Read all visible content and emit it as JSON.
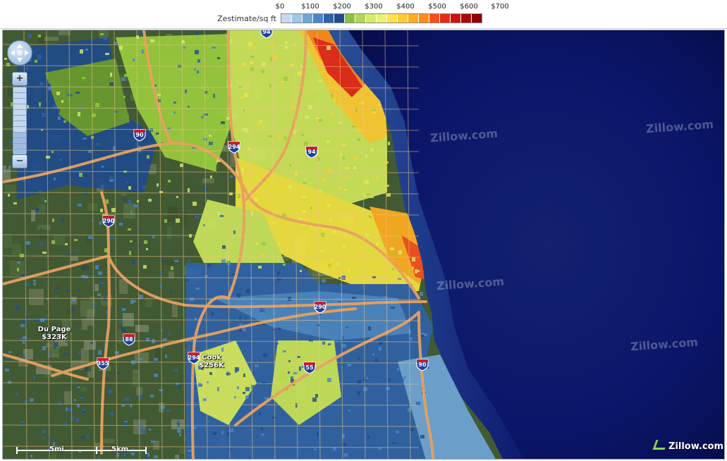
{
  "legend": {
    "title": "Zestimate/sq ft",
    "tick_labels": [
      "$0",
      "$100",
      "$200",
      "$300",
      "$400",
      "$500",
      "$600",
      "$700"
    ],
    "swatch_colors": [
      "#c6dbef",
      "#9ecae1",
      "#6fa5d6",
      "#4a86c5",
      "#2f62a8",
      "#1f4b8a",
      "#8fbf3f",
      "#b3d65a",
      "#d6eb6a",
      "#eef26a",
      "#ffe24a",
      "#ffcc33",
      "#ffad1f",
      "#ff8c1a",
      "#f4511e",
      "#e62a17",
      "#cf1010",
      "#a80909",
      "#8b0000"
    ]
  },
  "map": {
    "watermarks": [
      "Zillow.com",
      "Zillow.com",
      "Zillow.com",
      "Zillow.com"
    ],
    "highways": [
      "94",
      "90",
      "294",
      "94",
      "290",
      "290",
      "88",
      "355",
      "294",
      "55",
      "90"
    ],
    "counties": [
      {
        "name": "Du Page",
        "value": "$323K"
      },
      {
        "name": "Cook",
        "value": "$256K"
      }
    ],
    "logo": "Zillow.com",
    "scale": {
      "miles": "5mi",
      "km": "5km"
    },
    "colors": {
      "lake": "#0b1a6e",
      "land": "#3c5a2c",
      "roads": "#e8a060",
      "interstate_blue": "#1e3f9a",
      "interstate_red": "#c8202a"
    }
  },
  "controls": {
    "pan_icon": "pan-arrows-icon",
    "zoom_in_glyph": "+",
    "zoom_out_glyph": "−",
    "zoom_level_fraction": 0.35
  }
}
